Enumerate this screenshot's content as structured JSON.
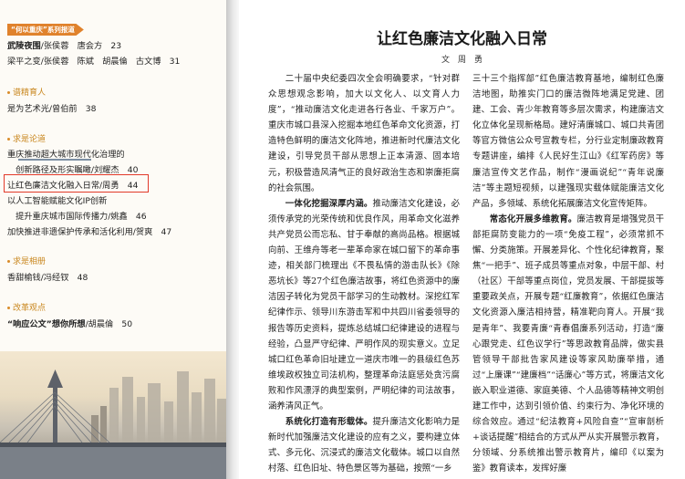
{
  "toc": {
    "tag": "“何以重庆”系列报道",
    "lines": [
      {
        "bold": "武陵夜围",
        "rest": "/张侯蓉　唐会方　23"
      },
      {
        "bold": "",
        "rest": "梁平之变/张侯蓉　陈斌　胡晨倫　古文博　31"
      }
    ],
    "sections": [
      {
        "name": "谱精育人",
        "entries": [
          "是为艺术光/曾伯前　38"
        ]
      },
      {
        "name": "求是论道",
        "entries": [
          "重庆推动超大城市现代化治理的",
          "　创新路径及形实瞩瞰/刘耀杰　40",
          "让红色廉洁文化融入日常/周勇　44",
          "以人工智能赋能文化IP创新",
          "　提升重庆城市国际传播力/姚鑫　46",
          "加快推进非遗保护传承和活化利用/贺爽　47"
        ]
      },
      {
        "name": "求是相册",
        "entries": [
          "香甜榆钱/冯经钗　48"
        ]
      },
      {
        "name": "改革观点",
        "entries": [
          {
            "bold": "“响应公文”想你所想",
            "rest": "/胡晨倫　50"
          }
        ]
      }
    ]
  },
  "article": {
    "title": "让红色廉洁文化融入日常",
    "author": "文　周　勇",
    "left_column": [
      {
        "type": "p",
        "text": "二十届中央纪委四次全会明确要求，“针对群众思想观念影响，加大以文化人、以文育人力度”，“推动廉洁文化走进各行各业、千家万户”。重庆市城口县深入挖掘本地红色革命文化资源，打造特色鲜明的廉洁文化阵地，推进新时代廉洁文化建设，引导党员干部从思想上正本清源、固本培元，积极营造风清气正的良好政治生态和崇廉拒腐的社会氛围。"
      },
      {
        "type": "p",
        "head": "一体化挖掘深厚内涵。",
        "text": "推动廉洁文化建设，必须传承党的光荣传统和优良作风，用革命文化滋养共产党员公而忘私、甘于奉献的高尚品格。根据城向前、王维舟等老一辈革命家在城口留下的革命事迹，相关部门梳理出《不畏私情的游击队长》《除恶坑长》等27个红色廉洁故事，将红色资源中的廉洁因子转化为党员干部学习的生动教材。深挖红军纪律作示、领导川东游击军和中共四川省委领导的报告等历史资料，提炼总结城口纪律建设的进程与经验，凸显严守纪律、严明作风的现实意义。立足城口红色革命旧址建立一道庆市唯一的县级红色苏维埃政权独立司法机构，整理革命法庭惩处贪污腐败和作风漂浮的典型案例，严明纪律的司法故事，涵养清风正气。"
      },
      {
        "type": "p",
        "head": "系统化打造有形载体。",
        "text": "提升廉洁文化影响力是新时代加强廉洁文化建设的应有之义，要构建立体式、多元化、沉浸式的廉洁文化载体。城口以自然村落、红色旧址、特色景区等为基础，按照“一乡"
      }
    ],
    "right_column": [
      {
        "type": "p",
        "text": "三十三个指挥部”红色廉洁教育基地，编制红色廉洁地图，助推实门口的廉洁微阵地满足党建、团建、工会、青少年教育等多层次需求，构建廉洁文化立体化呈现新格局。建好清廉城口、城口共青团等官方微信公众号宣教专栏，分行业定制廉政教育专题讲座，编排《人民好生江山》《红军药房》等廉洁宣传文艺作品，制作“漫画说纪”“青年说廉洁”等主题短视频，以建强现实载体赋能廉洁文化产品，多领域、系统化拓展廉洁文化宣传矩阵。"
      },
      {
        "type": "p",
        "head": "常态化开展多维教育。",
        "text": "廉洁教育是增强党员干部拒腐防变能力的一项“免疫工程”，必须常抓不懈、分类施策。开展差异化、个性化纪律教育，聚焦“一把手”、班子成员等重点对象，中层干部、村（社区）干部等重点岗位，党员发展、干部提拔等重要政关点，开展专题“红廉教育”，依据红色廉洁文化资源入廉洁相持营，精准靶向育人。开展“我是青年”、我要青廉“青春倡廉系列活动，打造“廉心跟党走、红色议学行”等思政教育品牌，做实县管领导干部批告家风建设等家风助廉举措，通过“上廉课”“建廉档”“话廉心”等方式，将廉洁文化嵌入职业道德、家庭美德、个人品德等精神文明创建工作中，达到引领价值、约束行为、净化环境的综合效应。通过“纪法教育+风险自查”“宣审剖析+谈话提醒”相结合的方式从严从实开展警示教育，分领域、分系统推出警示教育片，编印《以案为鉴》教育读本，发挥好廉"
      }
    ]
  }
}
